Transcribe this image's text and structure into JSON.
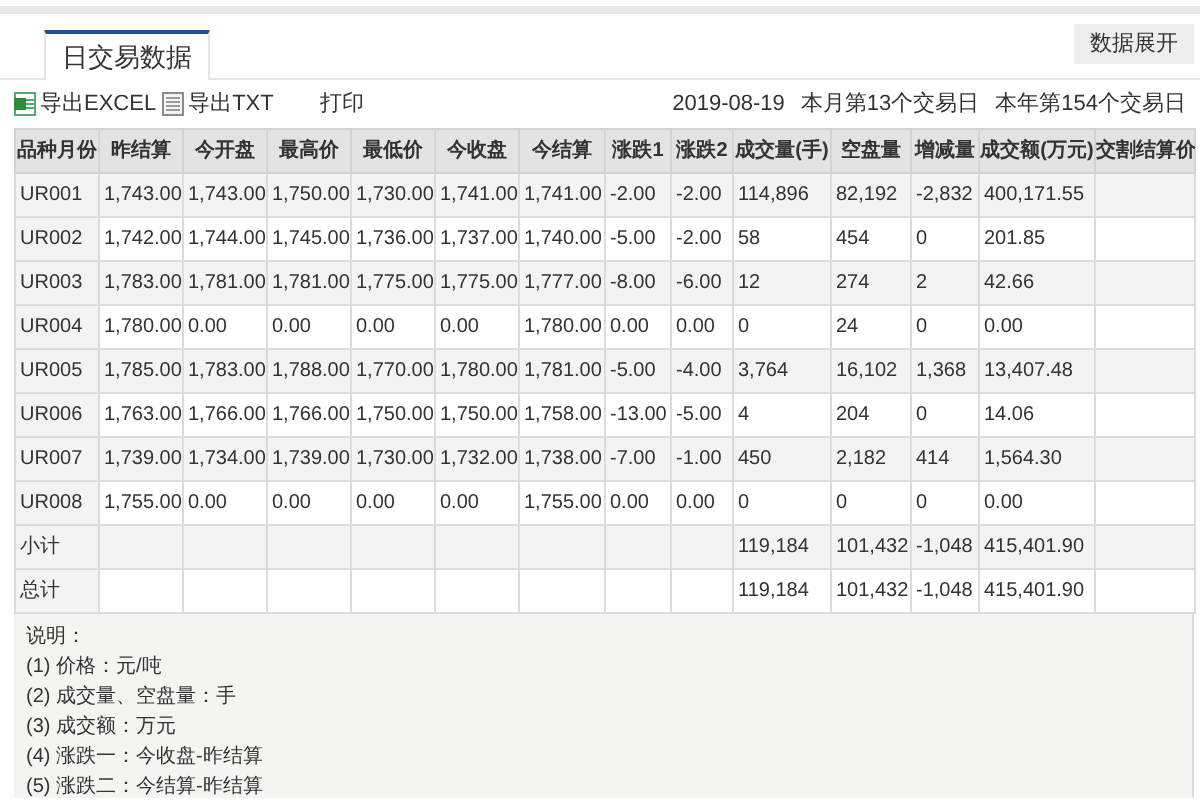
{
  "tabs": [
    {
      "label": "日交易数据",
      "selected": true
    }
  ],
  "expand_button": "数据展开",
  "toolbar": [
    {
      "kind": "excel",
      "label": "导出EXCEL"
    },
    {
      "kind": "txt",
      "label": "导出TXT"
    },
    {
      "kind": "plain",
      "label": "打印"
    }
  ],
  "trade_info": [
    "2019-08-19",
    "本月第13个交易日",
    "本年第154个交易日"
  ],
  "table": {
    "columns": [
      "品种月份",
      "昨结算",
      "今开盘",
      "最高价",
      "最低价",
      "今收盘",
      "今结算",
      "涨跌1",
      "涨跌2",
      "成交量(手)",
      "空盘量",
      "增减量",
      "成交额(万元)",
      "交割结算价"
    ],
    "rows": [
      [
        "UR001",
        "1,743.00",
        "1,743.00",
        "1,750.00",
        "1,730.00",
        "1,741.00",
        "1,741.00",
        "-2.00",
        "-2.00",
        "114,896",
        "82,192",
        "-2,832",
        "400,171.55",
        null
      ],
      [
        "UR002",
        "1,742.00",
        "1,744.00",
        "1,745.00",
        "1,736.00",
        "1,737.00",
        "1,740.00",
        "-5.00",
        "-2.00",
        "58",
        "454",
        "0",
        "201.85",
        null
      ],
      [
        "UR003",
        "1,783.00",
        "1,781.00",
        "1,781.00",
        "1,775.00",
        "1,775.00",
        "1,777.00",
        "-8.00",
        "-6.00",
        "12",
        "274",
        "2",
        "42.66",
        null
      ],
      [
        "UR004",
        "1,780.00",
        "0.00",
        "0.00",
        "0.00",
        "0.00",
        "1,780.00",
        "0.00",
        "0.00",
        "0",
        "24",
        "0",
        "0.00",
        null
      ],
      [
        "UR005",
        "1,785.00",
        "1,783.00",
        "1,788.00",
        "1,770.00",
        "1,780.00",
        "1,781.00",
        "-5.00",
        "-4.00",
        "3,764",
        "16,102",
        "1,368",
        "13,407.48",
        null
      ],
      [
        "UR006",
        "1,763.00",
        "1,766.00",
        "1,766.00",
        "1,750.00",
        "1,750.00",
        "1,758.00",
        "-13.00",
        "-5.00",
        "4",
        "204",
        "0",
        "14.06",
        null
      ],
      [
        "UR007",
        "1,739.00",
        "1,734.00",
        "1,739.00",
        "1,730.00",
        "1,732.00",
        "1,738.00",
        "-7.00",
        "-1.00",
        "450",
        "2,182",
        "414",
        "1,564.30",
        null
      ],
      [
        "UR008",
        "1,755.00",
        "0.00",
        "0.00",
        "0.00",
        "0.00",
        "1,755.00",
        "0.00",
        "0.00",
        "0",
        "0",
        "0",
        "0.00",
        null
      ],
      [
        "小计",
        null,
        null,
        null,
        null,
        null,
        null,
        null,
        null,
        "119,184",
        "101,432",
        "-1,048",
        "415,401.90",
        null
      ],
      [
        "总计",
        null,
        null,
        null,
        null,
        null,
        null,
        null,
        null,
        "119,184",
        "101,432",
        "-1,048",
        "415,401.90",
        null
      ]
    ]
  },
  "notes": {
    "title": "说明：",
    "lines": [
      "(1) 价格：元/吨",
      "(2) 成交量、空盘量：手",
      "(3) 成交额：万元",
      "(4) 涨跌一：今收盘-昨结算",
      "(5) 涨跌二：今结算-昨结算"
    ]
  }
}
